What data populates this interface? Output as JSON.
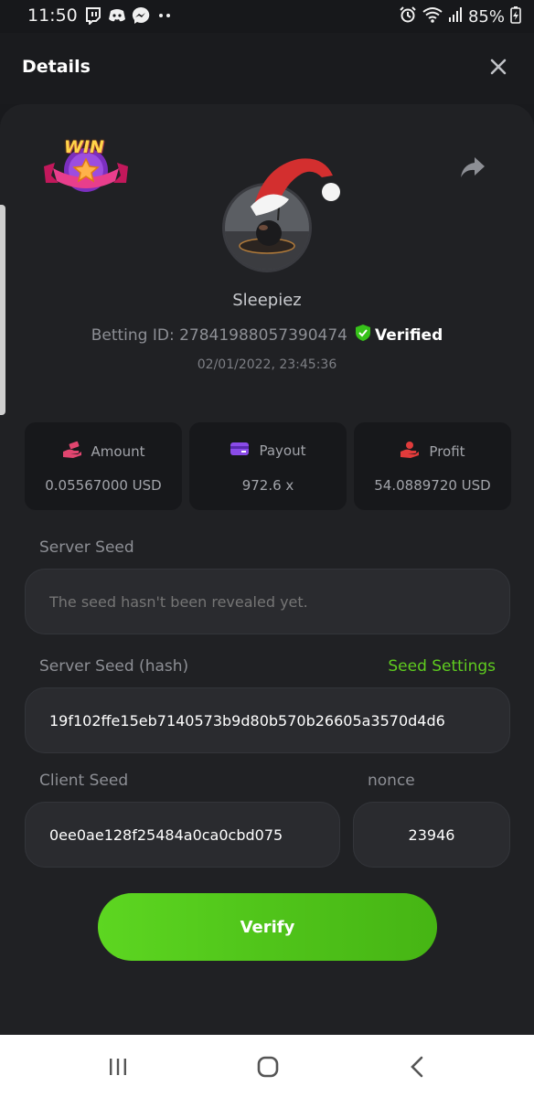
{
  "status_bar": {
    "time": "11:50",
    "battery": "85%",
    "notification_icons": [
      "twitch-icon",
      "discord-icon",
      "messenger-icon",
      "more-dots-icon"
    ],
    "system_icons": [
      "alarm-icon",
      "wifi-icon",
      "signal-icon",
      "battery-charging-icon"
    ]
  },
  "header": {
    "title": "Details"
  },
  "badge": {
    "text": "WIN"
  },
  "profile": {
    "username": "Sleepiez",
    "betting_id": "Betting ID: 27841988057390474",
    "verified_label": "Verified",
    "datetime": "02/01/2022, 23:45:36"
  },
  "stats": [
    {
      "label": "Amount",
      "value": "0.05567000 USD",
      "icon": "money-hand-icon",
      "color": "#e0456f"
    },
    {
      "label": "Payout",
      "value": "972.6 x",
      "icon": "card-icon",
      "color": "#8a4be8"
    },
    {
      "label": "Profit",
      "value": "54.0889720 USD",
      "icon": "profit-hand-icon",
      "color": "#e03b3b"
    }
  ],
  "server_seed": {
    "label": "Server Seed",
    "placeholder": "The seed hasn't been revealed yet."
  },
  "server_seed_hash": {
    "label": "Server Seed (hash)",
    "link": "Seed Settings",
    "value": "19f102ffe15eb7140573b9d80b570b26605a3570d4d6"
  },
  "client_seed": {
    "label": "Client Seed",
    "value": "0ee0ae128f25484a0ca0cbd075"
  },
  "nonce": {
    "label": "nonce",
    "value": "23946"
  },
  "verify_button": "Verify",
  "colors": {
    "accent_green": "#5fcc1f",
    "background": "#191a1d",
    "sheet": "#202124"
  }
}
